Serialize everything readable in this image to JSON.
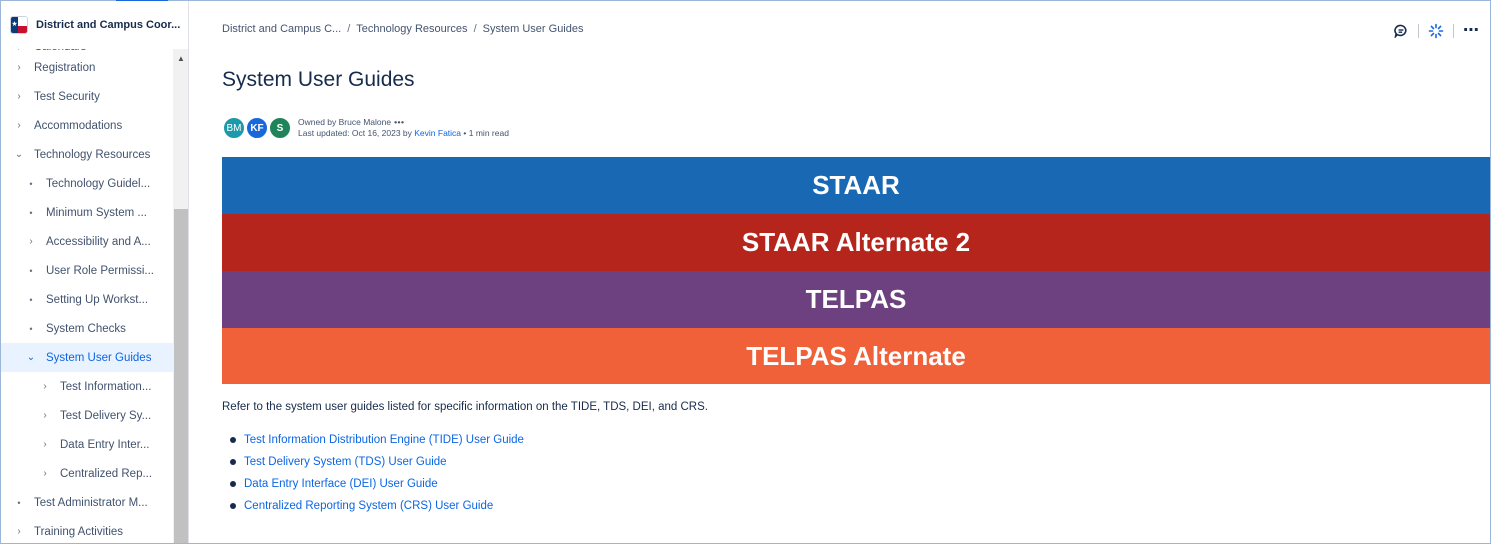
{
  "window": {
    "space_name": "District and Campus Coor..."
  },
  "sidebar": {
    "items": [
      {
        "label": "Calendars",
        "marker": "chevron-right-icon"
      },
      {
        "label": "Registration",
        "marker": "chevron-right-icon"
      },
      {
        "label": "Test Security",
        "marker": "chevron-right-icon"
      },
      {
        "label": "Accommodations",
        "marker": "chevron-right-icon"
      },
      {
        "label": "Technology Resources",
        "marker": "chevron-down-icon"
      },
      {
        "label": "Technology Guidel...",
        "marker": "bullet-icon"
      },
      {
        "label": "Minimum System ...",
        "marker": "bullet-icon"
      },
      {
        "label": "Accessibility and A...",
        "marker": "chevron-right-icon"
      },
      {
        "label": "User Role Permissi...",
        "marker": "bullet-icon"
      },
      {
        "label": "Setting Up Workst...",
        "marker": "bullet-icon"
      },
      {
        "label": "System Checks",
        "marker": "bullet-icon"
      },
      {
        "label": "System User Guides",
        "marker": "chevron-down-icon",
        "selected": true
      },
      {
        "label": "Test Information...",
        "marker": "chevron-right-icon"
      },
      {
        "label": "Test Delivery Sy...",
        "marker": "chevron-right-icon"
      },
      {
        "label": "Data Entry Inter...",
        "marker": "chevron-right-icon"
      },
      {
        "label": "Centralized Rep...",
        "marker": "chevron-right-icon"
      },
      {
        "label": "Test Administrator M...",
        "marker": "bullet-icon"
      },
      {
        "label": "Training Activities",
        "marker": "chevron-right-icon"
      }
    ]
  },
  "breadcrumb": {
    "items": [
      "District and Campus C...",
      "Technology Resources",
      "System User Guides"
    ],
    "separator": "/"
  },
  "page": {
    "title": "System User Guides",
    "owner_text": "Owned by Bruce Malone",
    "updated_prefix": "Last updated: Oct 16, 2023 by",
    "updated_by": "Kevin Fatica",
    "read_time": "• 1 min read",
    "avatars": [
      "BM",
      "KF",
      "S"
    ]
  },
  "banners": [
    {
      "label": "STAAR",
      "color": "#1968b4"
    },
    {
      "label": "STAAR Alternate 2",
      "color": "#b5251c"
    },
    {
      "label": "TELPAS",
      "color": "#6d4080"
    },
    {
      "label": "TELPAS Alternate",
      "color": "#f06039"
    }
  ],
  "content": {
    "intro": "Refer to the system user guides listed for specific information on the TIDE, TDS, DEI, and CRS.",
    "links": [
      "Test Information Distribution Engine (TIDE) User Guide",
      "Test Delivery System (TDS) User Guide",
      "Data Entry Interface (DEI) User Guide",
      "Centralized Reporting System (CRS) User Guide"
    ]
  },
  "colors": {
    "accent": "#1868db",
    "link": "#0c66e4",
    "selected_bg": "#e9f2ff"
  }
}
